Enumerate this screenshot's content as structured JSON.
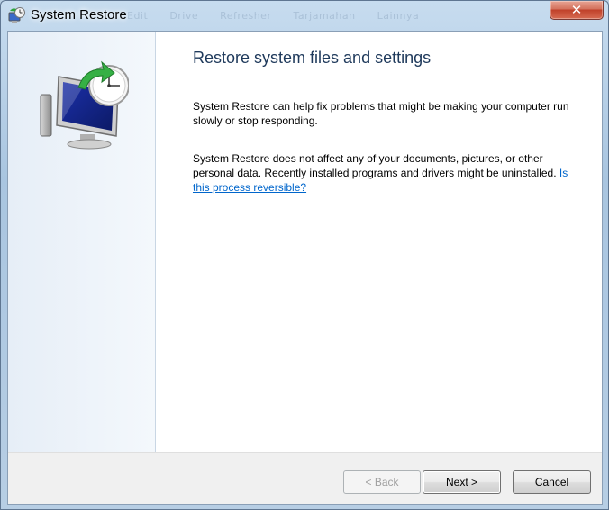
{
  "window": {
    "title": "System Restore",
    "close_label": "✕",
    "ghost_tabs": [
      "Edit",
      "Drive",
      "Refresher",
      "Tarjamahan",
      "Lainnya"
    ]
  },
  "content": {
    "heading": "Restore system files and settings",
    "paragraph1": "System Restore can help fix problems that might be making your computer run slowly or stop responding.",
    "paragraph2": "System Restore does not affect any of your documents, pictures, or other personal data. Recently installed programs and drivers might be uninstalled.",
    "link_text": "Is this process reversible?"
  },
  "buttons": {
    "back": "< Back",
    "next": "Next >",
    "cancel": "Cancel"
  },
  "icons": {
    "title_icon": "system-restore-icon",
    "hero_icon": "computer-restore-clock-icon"
  },
  "colors": {
    "heading": "#1e395b",
    "link": "#0066cc",
    "close": "#c0412a"
  }
}
